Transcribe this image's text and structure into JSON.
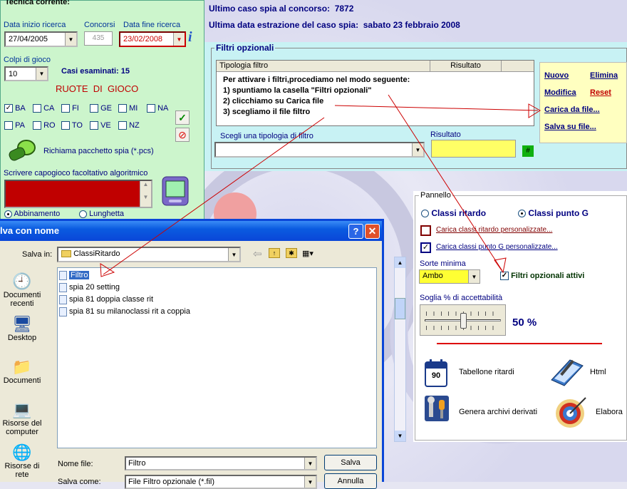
{
  "left": {
    "legend": "Tecnica corrente:",
    "data_inizio_label": "Data inizio ricerca",
    "data_inizio_value": "27/04/2005",
    "concorsi_label": "Concorsi",
    "concorsi_value": "435",
    "data_fine_label": "Data fine ricerca",
    "data_fine_value": "23/02/2008",
    "colpi_label": "Colpi di gioco",
    "colpi_value": "10",
    "casi_label": "Casi esaminati: 15",
    "ruote_title": "RUOTE  DI  GIOCO",
    "ruote": [
      {
        "name": "BA",
        "checked": true
      },
      {
        "name": "CA",
        "checked": false
      },
      {
        "name": "FI",
        "checked": false
      },
      {
        "name": "GE",
        "checked": false
      },
      {
        "name": "MI",
        "checked": false
      },
      {
        "name": "NA",
        "checked": false
      },
      {
        "name": "PA",
        "checked": false
      },
      {
        "name": "RO",
        "checked": false
      },
      {
        "name": "TO",
        "checked": false
      },
      {
        "name": "VE",
        "checked": false
      },
      {
        "name": "NZ",
        "checked": false
      }
    ],
    "richiama": "Richiama pacchetto spia (*.pcs)",
    "capogioco_label": "Scrivere capogioco facoltativo algoritmico",
    "abbinamento": "Abbinamento",
    "lunghetta": "Lunghetta"
  },
  "header": {
    "line1": "Ultimo caso spia al concorso:  7872",
    "line2": "Ultima data estrazione del caso spia:  sabato 23 febbraio 2008"
  },
  "filtri": {
    "legend": "Filtri opzionali",
    "col1": "Tipologia filtro",
    "col2": "Risultato",
    "instructions": [
      "Per attivare i filtri,procediamo nel modo seguente:",
      "1) spuntiamo la casella \"Filtri opzionali\"",
      "2) clicchiamo su Carica file",
      "3) scegliamo il file filtro"
    ],
    "scegli_label": "Scegli una tipologia di filtro",
    "risultato_label": "Risultato",
    "hash_btn": "#"
  },
  "links": {
    "nuovo": "Nuovo",
    "elimina": "Elimina",
    "modifica": "Modifica",
    "reset": "Reset",
    "carica": "Carica da file...",
    "salva": "Salva su file..."
  },
  "pannello": {
    "legend": "Pannello",
    "classi_ritardo": "Classi ritardo",
    "classi_punto_g": "Classi punto G",
    "carica_ritardo": "Carica classi ritardo personalizzate...",
    "carica_punto_g": "Carica classi punto G personalizzate...",
    "sorte_label": "Sorte minima",
    "sorte_value": "Ambo",
    "filtri_attivi": "Filtri opzionali attivi",
    "soglia_label": "Soglia % di accettabilità",
    "soglia_value": "50 %",
    "soglia_fraction": 0.5,
    "tabellone": "Tabellone ritardi",
    "html": "Html",
    "genera": "Genera archivi derivati",
    "elabora": "Elabora",
    "calendar_num": "90"
  },
  "dialog": {
    "title": "lva con nome",
    "salva_in_label": "Salva in:",
    "salva_in_value": "ClassiRitardo",
    "places": [
      "Documenti recenti",
      "Desktop",
      "Documenti",
      "Risorse del computer",
      "Risorse di rete"
    ],
    "files": [
      "Filtro",
      "spia 20 setting",
      "spia 81 doppia classe rit",
      "spia 81 su milanoclassi rit a coppia"
    ],
    "nome_file_label": "Nome file:",
    "nome_file_value": "Filtro",
    "salva_come_label": "Salva come:",
    "salva_come_value": "File Filtro opzionale (*.fil)",
    "salva_btn": "Salva",
    "annulla_btn": "Annulla"
  },
  "colors": {
    "left_bg": "#ccf5cc",
    "right_bg": "#c8f2f4",
    "dialog_blue": "#0a46d8",
    "red_field": "#c00000",
    "yellow": "#ffff66"
  }
}
